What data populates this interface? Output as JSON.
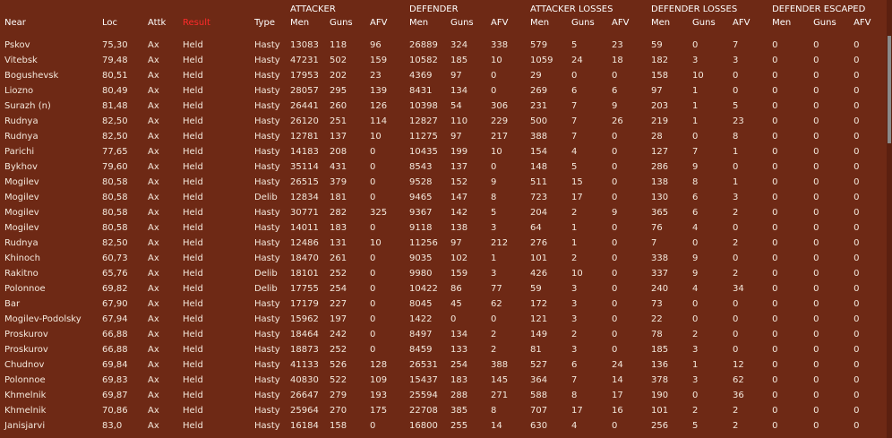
{
  "group_headers": {
    "attacker": "ATTACKER",
    "defender": "DEFENDER",
    "attacker_losses": "ATTACKER LOSSES",
    "defender_losses": "DEFENDER LOSSES",
    "defender_escaped": "DEFENDER ESCAPED"
  },
  "columns": {
    "near": "Near",
    "loc": "Loc",
    "attk": "Attk",
    "result": "Result",
    "type": "Type",
    "a_men": "Men",
    "a_guns": "Guns",
    "a_afv": "AFV",
    "d_men": "Men",
    "d_guns": "Guns",
    "d_afv": "AFV",
    "al_men": "Men",
    "al_guns": "Guns",
    "al_afv": "AFV",
    "dl_men": "Men",
    "dl_guns": "Guns",
    "dl_afv": "AFV",
    "de_men": "Men",
    "de_guns": "Guns",
    "de_afv": "AFV"
  },
  "colors": {
    "background": "#6e2915",
    "text": "#f3e8dc",
    "header": "#ffffff",
    "result_header": "#ff2a2a"
  },
  "rows": [
    [
      "Pskov",
      "75,30",
      "Ax",
      "Held",
      "Hasty",
      "13083",
      "118",
      "96",
      "26889",
      "324",
      "338",
      "579",
      "5",
      "23",
      "59",
      "0",
      "7",
      "0",
      "0",
      "0"
    ],
    [
      "Vitebsk",
      "79,48",
      "Ax",
      "Held",
      "Hasty",
      "47231",
      "502",
      "159",
      "10582",
      "185",
      "10",
      "1059",
      "24",
      "18",
      "182",
      "3",
      "3",
      "0",
      "0",
      "0"
    ],
    [
      "Bogushevsk",
      "80,51",
      "Ax",
      "Held",
      "Hasty",
      "17953",
      "202",
      "23",
      "4369",
      "97",
      "0",
      "29",
      "0",
      "0",
      "158",
      "10",
      "0",
      "0",
      "0",
      "0"
    ],
    [
      "Liozno",
      "80,49",
      "Ax",
      "Held",
      "Hasty",
      "28057",
      "295",
      "139",
      "8431",
      "134",
      "0",
      "269",
      "6",
      "6",
      "97",
      "1",
      "0",
      "0",
      "0",
      "0"
    ],
    [
      "Surazh (n)",
      "81,48",
      "Ax",
      "Held",
      "Hasty",
      "26441",
      "260",
      "126",
      "10398",
      "54",
      "306",
      "231",
      "7",
      "9",
      "203",
      "1",
      "5",
      "0",
      "0",
      "0"
    ],
    [
      "Rudnya",
      "82,50",
      "Ax",
      "Held",
      "Hasty",
      "26120",
      "251",
      "114",
      "12827",
      "110",
      "229",
      "500",
      "7",
      "26",
      "219",
      "1",
      "23",
      "0",
      "0",
      "0"
    ],
    [
      "Rudnya",
      "82,50",
      "Ax",
      "Held",
      "Hasty",
      "12781",
      "137",
      "10",
      "11275",
      "97",
      "217",
      "388",
      "7",
      "0",
      "28",
      "0",
      "8",
      "0",
      "0",
      "0"
    ],
    [
      "Parichi",
      "77,65",
      "Ax",
      "Held",
      "Hasty",
      "14183",
      "208",
      "0",
      "10435",
      "199",
      "10",
      "154",
      "4",
      "0",
      "127",
      "7",
      "1",
      "0",
      "0",
      "0"
    ],
    [
      "Bykhov",
      "79,60",
      "Ax",
      "Held",
      "Hasty",
      "35114",
      "431",
      "0",
      "8543",
      "137",
      "0",
      "148",
      "5",
      "0",
      "286",
      "9",
      "0",
      "0",
      "0",
      "0"
    ],
    [
      "Mogilev",
      "80,58",
      "Ax",
      "Held",
      "Hasty",
      "26515",
      "379",
      "0",
      "9528",
      "152",
      "9",
      "511",
      "15",
      "0",
      "138",
      "8",
      "1",
      "0",
      "0",
      "0"
    ],
    [
      "Mogilev",
      "80,58",
      "Ax",
      "Held",
      "Delib",
      "12834",
      "181",
      "0",
      "9465",
      "147",
      "8",
      "723",
      "17",
      "0",
      "130",
      "6",
      "3",
      "0",
      "0",
      "0"
    ],
    [
      "Mogilev",
      "80,58",
      "Ax",
      "Held",
      "Hasty",
      "30771",
      "282",
      "325",
      "9367",
      "142",
      "5",
      "204",
      "2",
      "9",
      "365",
      "6",
      "2",
      "0",
      "0",
      "0"
    ],
    [
      "Mogilev",
      "80,58",
      "Ax",
      "Held",
      "Hasty",
      "14011",
      "183",
      "0",
      "9118",
      "138",
      "3",
      "64",
      "1",
      "0",
      "76",
      "4",
      "0",
      "0",
      "0",
      "0"
    ],
    [
      "Rudnya",
      "82,50",
      "Ax",
      "Held",
      "Hasty",
      "12486",
      "131",
      "10",
      "11256",
      "97",
      "212",
      "276",
      "1",
      "0",
      "7",
      "0",
      "2",
      "0",
      "0",
      "0"
    ],
    [
      "Khinoch",
      "60,73",
      "Ax",
      "Held",
      "Hasty",
      "18470",
      "261",
      "0",
      "9035",
      "102",
      "1",
      "101",
      "2",
      "0",
      "338",
      "9",
      "0",
      "0",
      "0",
      "0"
    ],
    [
      "Rakitno",
      "65,76",
      "Ax",
      "Held",
      "Delib",
      "18101",
      "252",
      "0",
      "9980",
      "159",
      "3",
      "426",
      "10",
      "0",
      "337",
      "9",
      "2",
      "0",
      "0",
      "0"
    ],
    [
      "Polonnoe",
      "69,82",
      "Ax",
      "Held",
      "Delib",
      "17755",
      "254",
      "0",
      "10422",
      "86",
      "77",
      "59",
      "3",
      "0",
      "240",
      "4",
      "34",
      "0",
      "0",
      "0"
    ],
    [
      "Bar",
      "67,90",
      "Ax",
      "Held",
      "Hasty",
      "17179",
      "227",
      "0",
      "8045",
      "45",
      "62",
      "172",
      "3",
      "0",
      "73",
      "0",
      "0",
      "0",
      "0",
      "0"
    ],
    [
      "Mogilev-Podolsky",
      "67,94",
      "Ax",
      "Held",
      "Hasty",
      "15962",
      "197",
      "0",
      "1422",
      "0",
      "0",
      "121",
      "3",
      "0",
      "22",
      "0",
      "0",
      "0",
      "0",
      "0"
    ],
    [
      "Proskurov",
      "66,88",
      "Ax",
      "Held",
      "Hasty",
      "18464",
      "242",
      "0",
      "8497",
      "134",
      "2",
      "149",
      "2",
      "0",
      "78",
      "2",
      "0",
      "0",
      "0",
      "0"
    ],
    [
      "Proskurov",
      "66,88",
      "Ax",
      "Held",
      "Hasty",
      "18873",
      "252",
      "0",
      "8459",
      "133",
      "2",
      "81",
      "3",
      "0",
      "185",
      "3",
      "0",
      "0",
      "0",
      "0"
    ],
    [
      "Chudnov",
      "69,84",
      "Ax",
      "Held",
      "Hasty",
      "41133",
      "526",
      "128",
      "26531",
      "254",
      "388",
      "527",
      "6",
      "24",
      "136",
      "1",
      "12",
      "0",
      "0",
      "0"
    ],
    [
      "Polonnoe",
      "69,83",
      "Ax",
      "Held",
      "Hasty",
      "40830",
      "522",
      "109",
      "15437",
      "183",
      "145",
      "364",
      "7",
      "14",
      "378",
      "3",
      "62",
      "0",
      "0",
      "0"
    ],
    [
      "Khmelnik",
      "69,87",
      "Ax",
      "Held",
      "Hasty",
      "26647",
      "279",
      "193",
      "25594",
      "288",
      "271",
      "588",
      "8",
      "17",
      "190",
      "0",
      "36",
      "0",
      "0",
      "0"
    ],
    [
      "Khmelnik",
      "70,86",
      "Ax",
      "Held",
      "Hasty",
      "25964",
      "270",
      "175",
      "22708",
      "385",
      "8",
      "707",
      "17",
      "16",
      "101",
      "2",
      "2",
      "0",
      "0",
      "0"
    ],
    [
      "Janisjarvi",
      "83,0",
      "Ax",
      "Held",
      "Hasty",
      "16184",
      "158",
      "0",
      "16800",
      "255",
      "14",
      "630",
      "4",
      "0",
      "256",
      "5",
      "2",
      "0",
      "0",
      "0"
    ]
  ]
}
